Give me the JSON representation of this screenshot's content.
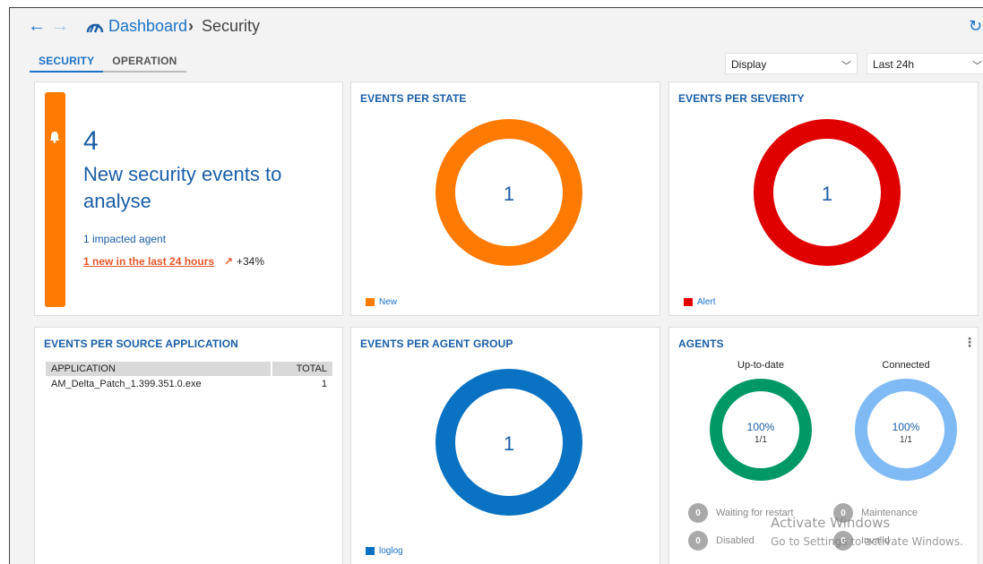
{
  "header": {
    "back_icon": "arrow-left-icon",
    "forward_icon": "arrow-right-icon",
    "breadcrumb_root": "Dashboard",
    "breadcrumb_separator": "›",
    "breadcrumb_current": "Security"
  },
  "tabs": [
    {
      "label": "SECURITY",
      "active": true
    },
    {
      "label": "OPERATION",
      "active": false
    }
  ],
  "filters": {
    "display_select": "Display",
    "range_select": "Last 24h"
  },
  "summary": {
    "count": "4",
    "headline": "New security events to analyse",
    "impacted": "1 impacted agent",
    "new_link": "1 new in the last 24 hours",
    "trend": "+34%",
    "accent_color": "#ff7a00"
  },
  "events_per_state": {
    "title": "EVENTS PER STATE",
    "total": "1",
    "legend": "New",
    "color": "#ff7a00"
  },
  "events_per_severity": {
    "title": "EVENTS PER SEVERITY",
    "total": "1",
    "legend": "Alert",
    "color": "#e00000"
  },
  "events_per_source": {
    "title": "EVENTS PER SOURCE APPLICATION",
    "columns": [
      "APPLICATION",
      "TOTAL"
    ],
    "rows": [
      {
        "application": "AM_Delta_Patch_1.399.351.0.exe",
        "total": "1"
      }
    ]
  },
  "events_per_group": {
    "title": "EVENTS PER AGENT GROUP",
    "total": "1",
    "legend": "loglog",
    "color": "#0a72c2"
  },
  "agents": {
    "title": "AGENTS",
    "up_to_date": {
      "label": "Up-to-date",
      "percent": "100%",
      "fraction": "1/1",
      "color": "#009966"
    },
    "connected": {
      "label": "Connected",
      "percent": "100%",
      "fraction": "1/1",
      "color": "#7fbaf5"
    },
    "stats": [
      {
        "count": "0",
        "label": "Waiting for restart"
      },
      {
        "count": "0",
        "label": "Maintenance"
      },
      {
        "count": "0",
        "label": "Disabled"
      },
      {
        "count": "0",
        "label": "Invalid"
      }
    ]
  },
  "watermark": {
    "line1": "Activate Windows",
    "line2": "Go to Settings to activate Windows."
  }
}
